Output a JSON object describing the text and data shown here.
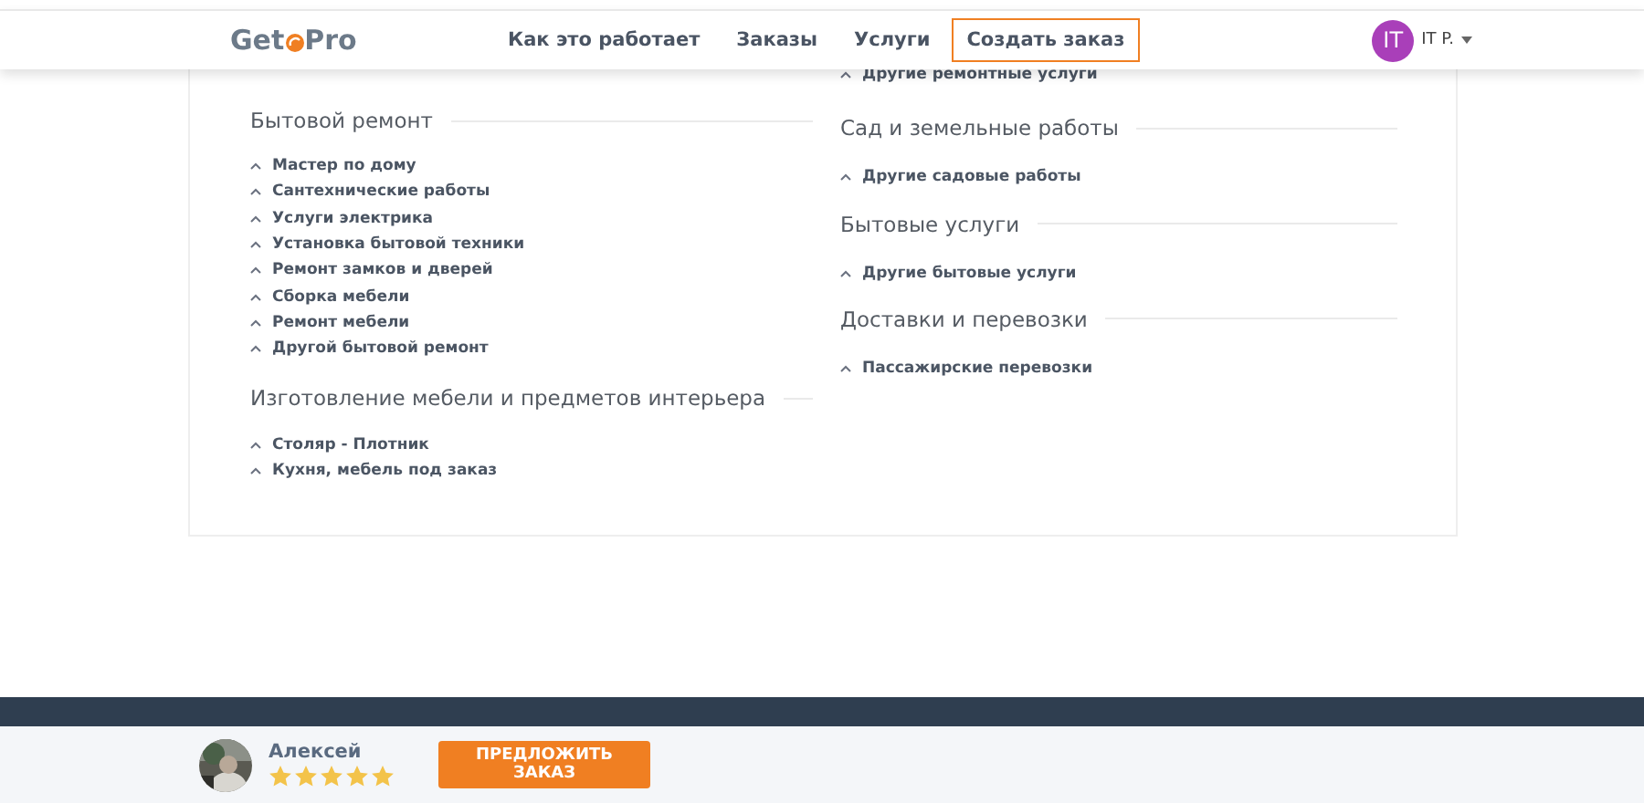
{
  "header": {
    "logo": {
      "before": "Get",
      "after": "Pro"
    },
    "nav": [
      {
        "label": "Как это работает",
        "selected": false
      },
      {
        "label": "Заказы",
        "selected": false
      },
      {
        "label": "Услуги",
        "selected": false
      },
      {
        "label": "Создать заказ",
        "selected": true
      }
    ],
    "user": {
      "initials": "IT",
      "name": "IT P."
    }
  },
  "columns": [
    [
      {
        "title": "Бытовой ремонт",
        "items": [
          "Мастер по дому",
          "Сантехнические работы",
          "Услуги электрика",
          "Установка бытовой техники",
          "Ремонт замков и дверей",
          "Сборка мебели",
          "Ремонт мебели",
          "Другой бытовой ремонт"
        ]
      },
      {
        "title": "Изготовление мебели и предметов интерьера",
        "items": [
          "Столяр - Плотник",
          "Кухня, мебель под заказ"
        ]
      }
    ],
    [
      {
        "items": [
          "Другие ремонтные услуги"
        ]
      },
      {
        "title": "Сад и земельные работы",
        "items": [
          "Другие садовые работы"
        ]
      },
      {
        "title": "Бытовые услуги",
        "items": [
          "Другие бытовые услуги"
        ]
      },
      {
        "title": "Доставки и перевозки",
        "items": [
          "Пассажирские перевозки"
        ]
      }
    ]
  ],
  "bottom_bar": {
    "name": "Алексей",
    "stars": 5,
    "button": "ПРЕДЛОЖИТЬ ЗАКАЗ"
  }
}
